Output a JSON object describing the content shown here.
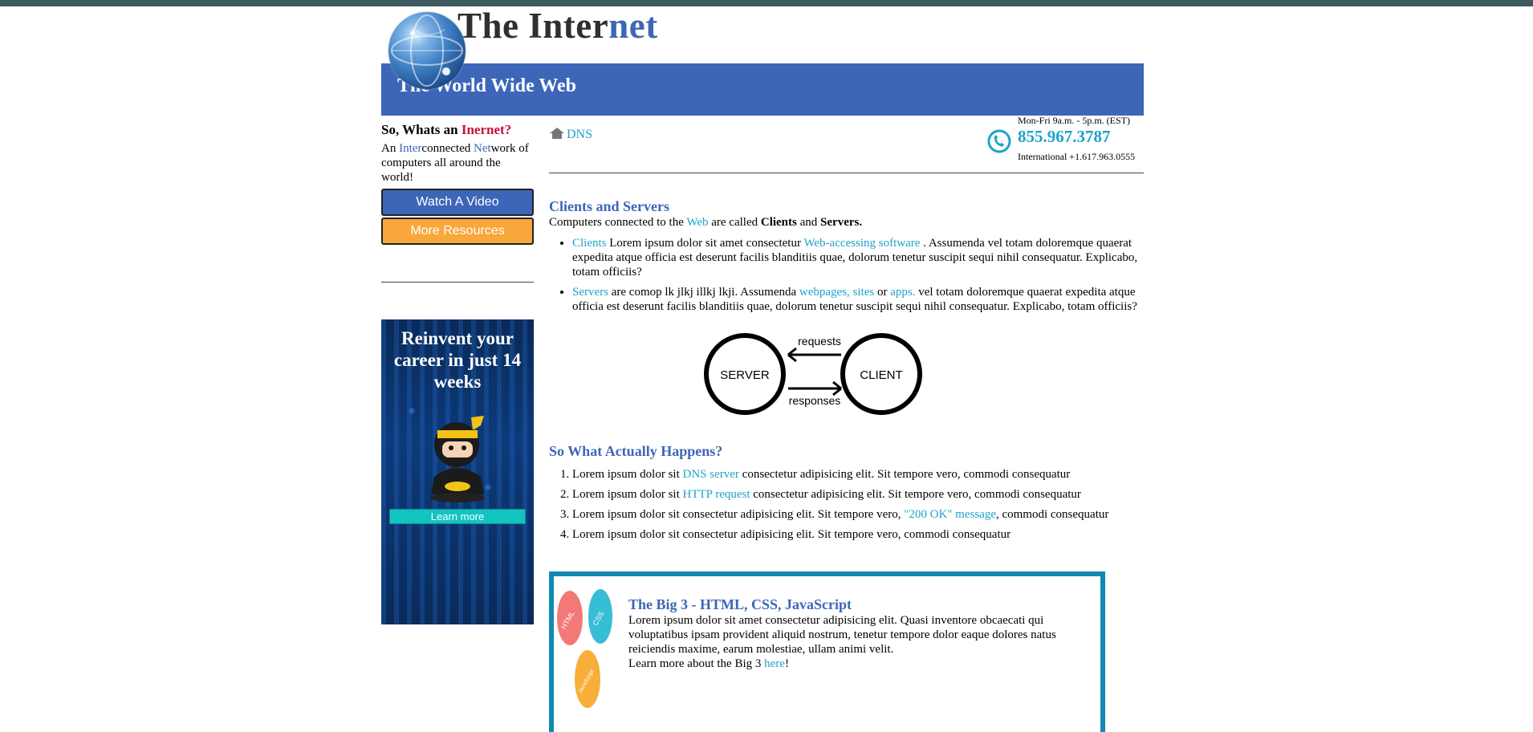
{
  "header": {
    "title_part1": "The Inter",
    "title_part2": "net",
    "banner": "The World Wide Web"
  },
  "sidebar": {
    "heading_part1": "So, Whats an ",
    "heading_accent": "Inernet?",
    "intro": {
      "a": "An ",
      "b": "Inter",
      "c": "connected ",
      "d": "Net",
      "e": "work of computers all around the world!"
    },
    "watch_button": "Watch A Video",
    "resources_button": "More Resources",
    "ad": {
      "title": "Reinvent your career in just 14 weeks",
      "learn_more": "Learn more"
    }
  },
  "breadcrumb": {
    "label": "DNS"
  },
  "contact": {
    "hours": "Mon-Fri 9a.m. - 5p.m. (EST)",
    "phone": "855.967.3787",
    "international": "International +1.617.963.0555"
  },
  "clients_servers": {
    "heading": "Clients and Servers",
    "intro_a": "Computers connected to the ",
    "intro_web": "Web",
    "intro_b": " are called ",
    "intro_clients": "Clients",
    "intro_and": " and ",
    "intro_servers": "Servers.",
    "bullet1": {
      "link1": "Clients",
      "t1": " Lorem ipsum dolor sit amet consectetur ",
      "link2": "Web-accessing software",
      "t2": " . Assumenda vel totam doloremque quaerat expedita atque officia est deserunt facilis blanditiis quae, dolorum tenetur suscipit sequi nihil consequatur. Explicabo, totam officiis?"
    },
    "bullet2": {
      "link1": "Servers",
      "t1": " are comop lk jlkj illkj lkji. Assumenda ",
      "link2": "webpages, sites",
      "t2": " or ",
      "link3": "apps.",
      "t3": " vel totam doloremque quaerat expedita atque officia est deserunt facilis blanditiis quae, dolorum tenetur suscipit sequi nihil consequatur. Explicabo, totam officiis?"
    },
    "diagram": {
      "server": "SERVER",
      "client": "CLIENT",
      "requests": "requests",
      "responses": "responses"
    }
  },
  "what_happens": {
    "heading": "So What Actually Happens?",
    "item1": {
      "a": "Lorem ipsum dolor sit ",
      "link": "DNS server",
      "b": " consectetur adipisicing elit. Sit tempore vero, commodi consequatur"
    },
    "item2": {
      "a": "Lorem ipsum dolor sit ",
      "link": "HTTP request",
      "b": " consectetur adipisicing elit. Sit tempore vero, commodi consequatur"
    },
    "item3": {
      "a": "Lorem ipsum dolor sit consectetur adipisicing elit. Sit tempore vero, ",
      "link": "\"200 OK\" message",
      "b": ", commodi consequatur"
    },
    "item4": "Lorem ipsum dolor sit consectetur adipisicing elit. Sit tempore vero, commodi consequatur"
  },
  "big3": {
    "heading": "The Big 3 - HTML, CSS, JavaScript",
    "body": "Lorem ipsum dolor sit amet consectetur adipisicing elit. Quasi inventore obcaecati qui voluptatibus ipsam provident aliquid nostrum, tenetur tempore dolor eaque dolores natus reiciendis maxime, earum molestiae, ullam animi velit.",
    "more_a": "Learn more about the Big 3 ",
    "more_link": "here",
    "more_b": "!",
    "badge_html": "HTML",
    "badge_css": "CSS",
    "badge_js": "JavaScript"
  },
  "colors": {
    "brand_blue": "#3d66b8",
    "link_teal": "#1fa3c8",
    "accent_red": "#c4123f",
    "orange": "#f9a73a",
    "frame_blue": "#1289b3"
  }
}
